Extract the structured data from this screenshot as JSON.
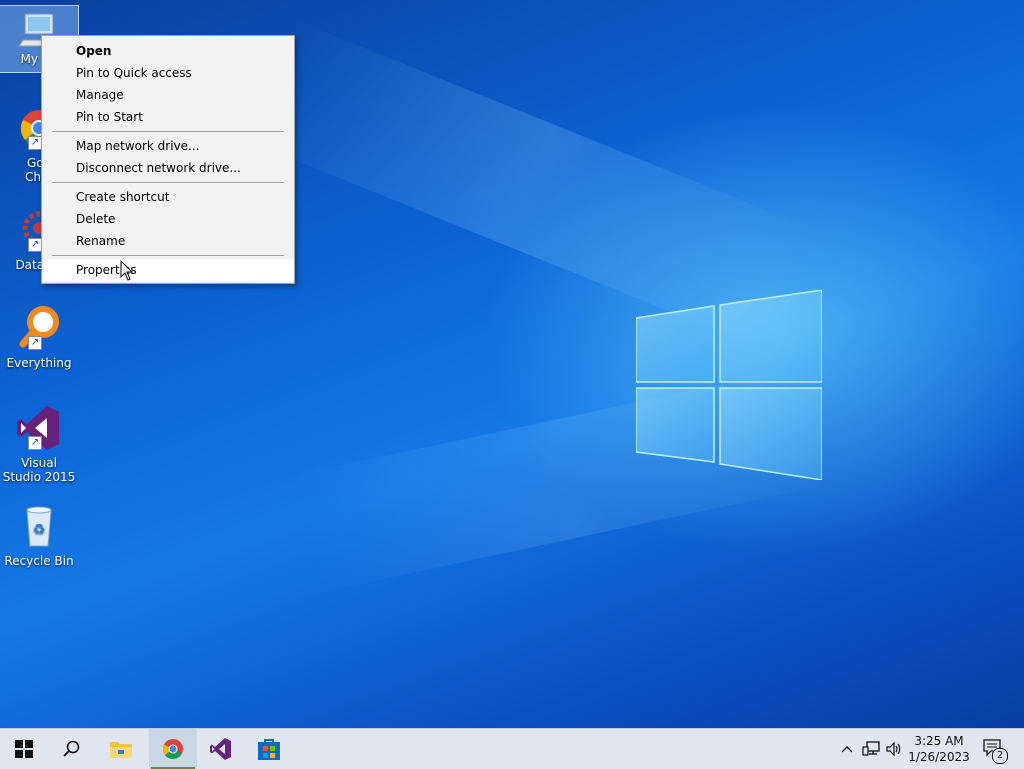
{
  "desktop": {
    "icons": [
      {
        "label": "My Computer",
        "shown_label": "My Co",
        "icon": "computer-icon"
      },
      {
        "label": "Google Chrome",
        "shown_label": "Goo\nChro",
        "icon": "chrome-icon"
      },
      {
        "label": "DataWa",
        "shown_label": "DataWa",
        "icon": "datawarrior-icon"
      },
      {
        "label": "Everything",
        "shown_label": "Everything",
        "icon": "everything-search-icon"
      },
      {
        "label": "Visual Studio 2015",
        "shown_label": "Visual Studio 2015",
        "icon": "visual-studio-icon"
      },
      {
        "label": "Recycle Bin",
        "shown_label": "Recycle Bin",
        "icon": "recycle-bin-icon"
      }
    ]
  },
  "context_menu": {
    "group1": [
      "Open",
      "Pin to Quick access",
      "Manage",
      "Pin to Start"
    ],
    "group2": [
      "Map network drive...",
      "Disconnect network drive..."
    ],
    "group3": [
      "Create shortcut",
      "Delete",
      "Rename"
    ],
    "group4": [
      "Properties"
    ],
    "hovered": "Properties"
  },
  "taskbar": {
    "buttons": [
      "start-icon",
      "search-icon",
      "file-explorer-icon",
      "chrome-icon",
      "visual-studio-icon",
      "store-icon"
    ],
    "active": "chrome-icon",
    "clock_time": "3:25 AM",
    "clock_date": "1/26/2023",
    "notification_count": "2"
  },
  "colors": {
    "accent": "#0c63d4",
    "taskbar": "#dfe6ef",
    "menu": "#f2f2f2"
  }
}
